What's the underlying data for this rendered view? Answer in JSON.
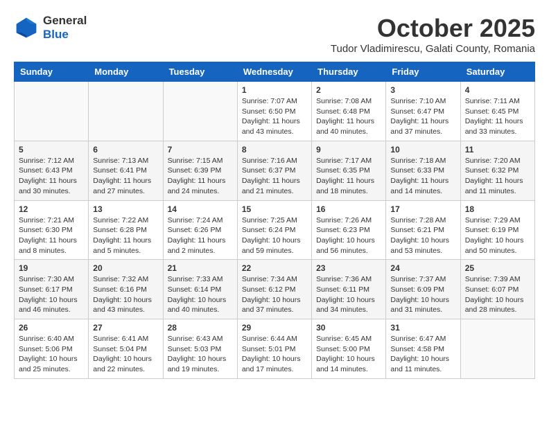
{
  "header": {
    "logo_general": "General",
    "logo_blue": "Blue",
    "month": "October 2025",
    "subtitle": "Tudor Vladimirescu, Galati County, Romania"
  },
  "weekdays": [
    "Sunday",
    "Monday",
    "Tuesday",
    "Wednesday",
    "Thursday",
    "Friday",
    "Saturday"
  ],
  "weeks": [
    [
      {
        "day": "",
        "info": ""
      },
      {
        "day": "",
        "info": ""
      },
      {
        "day": "",
        "info": ""
      },
      {
        "day": "1",
        "info": "Sunrise: 7:07 AM\nSunset: 6:50 PM\nDaylight: 11 hours\nand 43 minutes."
      },
      {
        "day": "2",
        "info": "Sunrise: 7:08 AM\nSunset: 6:48 PM\nDaylight: 11 hours\nand 40 minutes."
      },
      {
        "day": "3",
        "info": "Sunrise: 7:10 AM\nSunset: 6:47 PM\nDaylight: 11 hours\nand 37 minutes."
      },
      {
        "day": "4",
        "info": "Sunrise: 7:11 AM\nSunset: 6:45 PM\nDaylight: 11 hours\nand 33 minutes."
      }
    ],
    [
      {
        "day": "5",
        "info": "Sunrise: 7:12 AM\nSunset: 6:43 PM\nDaylight: 11 hours\nand 30 minutes."
      },
      {
        "day": "6",
        "info": "Sunrise: 7:13 AM\nSunset: 6:41 PM\nDaylight: 11 hours\nand 27 minutes."
      },
      {
        "day": "7",
        "info": "Sunrise: 7:15 AM\nSunset: 6:39 PM\nDaylight: 11 hours\nand 24 minutes."
      },
      {
        "day": "8",
        "info": "Sunrise: 7:16 AM\nSunset: 6:37 PM\nDaylight: 11 hours\nand 21 minutes."
      },
      {
        "day": "9",
        "info": "Sunrise: 7:17 AM\nSunset: 6:35 PM\nDaylight: 11 hours\nand 18 minutes."
      },
      {
        "day": "10",
        "info": "Sunrise: 7:18 AM\nSunset: 6:33 PM\nDaylight: 11 hours\nand 14 minutes."
      },
      {
        "day": "11",
        "info": "Sunrise: 7:20 AM\nSunset: 6:32 PM\nDaylight: 11 hours\nand 11 minutes."
      }
    ],
    [
      {
        "day": "12",
        "info": "Sunrise: 7:21 AM\nSunset: 6:30 PM\nDaylight: 11 hours\nand 8 minutes."
      },
      {
        "day": "13",
        "info": "Sunrise: 7:22 AM\nSunset: 6:28 PM\nDaylight: 11 hours\nand 5 minutes."
      },
      {
        "day": "14",
        "info": "Sunrise: 7:24 AM\nSunset: 6:26 PM\nDaylight: 11 hours\nand 2 minutes."
      },
      {
        "day": "15",
        "info": "Sunrise: 7:25 AM\nSunset: 6:24 PM\nDaylight: 10 hours\nand 59 minutes."
      },
      {
        "day": "16",
        "info": "Sunrise: 7:26 AM\nSunset: 6:23 PM\nDaylight: 10 hours\nand 56 minutes."
      },
      {
        "day": "17",
        "info": "Sunrise: 7:28 AM\nSunset: 6:21 PM\nDaylight: 10 hours\nand 53 minutes."
      },
      {
        "day": "18",
        "info": "Sunrise: 7:29 AM\nSunset: 6:19 PM\nDaylight: 10 hours\nand 50 minutes."
      }
    ],
    [
      {
        "day": "19",
        "info": "Sunrise: 7:30 AM\nSunset: 6:17 PM\nDaylight: 10 hours\nand 46 minutes."
      },
      {
        "day": "20",
        "info": "Sunrise: 7:32 AM\nSunset: 6:16 PM\nDaylight: 10 hours\nand 43 minutes."
      },
      {
        "day": "21",
        "info": "Sunrise: 7:33 AM\nSunset: 6:14 PM\nDaylight: 10 hours\nand 40 minutes."
      },
      {
        "day": "22",
        "info": "Sunrise: 7:34 AM\nSunset: 6:12 PM\nDaylight: 10 hours\nand 37 minutes."
      },
      {
        "day": "23",
        "info": "Sunrise: 7:36 AM\nSunset: 6:11 PM\nDaylight: 10 hours\nand 34 minutes."
      },
      {
        "day": "24",
        "info": "Sunrise: 7:37 AM\nSunset: 6:09 PM\nDaylight: 10 hours\nand 31 minutes."
      },
      {
        "day": "25",
        "info": "Sunrise: 7:39 AM\nSunset: 6:07 PM\nDaylight: 10 hours\nand 28 minutes."
      }
    ],
    [
      {
        "day": "26",
        "info": "Sunrise: 6:40 AM\nSunset: 5:06 PM\nDaylight: 10 hours\nand 25 minutes."
      },
      {
        "day": "27",
        "info": "Sunrise: 6:41 AM\nSunset: 5:04 PM\nDaylight: 10 hours\nand 22 minutes."
      },
      {
        "day": "28",
        "info": "Sunrise: 6:43 AM\nSunset: 5:03 PM\nDaylight: 10 hours\nand 19 minutes."
      },
      {
        "day": "29",
        "info": "Sunrise: 6:44 AM\nSunset: 5:01 PM\nDaylight: 10 hours\nand 17 minutes."
      },
      {
        "day": "30",
        "info": "Sunrise: 6:45 AM\nSunset: 5:00 PM\nDaylight: 10 hours\nand 14 minutes."
      },
      {
        "day": "31",
        "info": "Sunrise: 6:47 AM\nSunset: 4:58 PM\nDaylight: 10 hours\nand 11 minutes."
      },
      {
        "day": "",
        "info": ""
      }
    ]
  ]
}
